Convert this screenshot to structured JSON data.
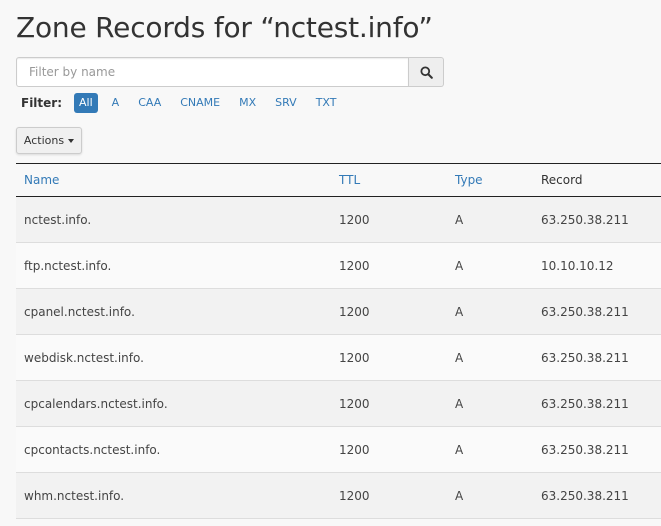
{
  "page": {
    "title": "Zone Records for “nctest.info”"
  },
  "search": {
    "placeholder": "Filter by name",
    "icon": "search-icon"
  },
  "filter": {
    "label": "Filter:",
    "options": [
      "All",
      "A",
      "CAA",
      "CNAME",
      "MX",
      "SRV",
      "TXT"
    ],
    "active": "All"
  },
  "actions": {
    "label": "Actions"
  },
  "table": {
    "columns": [
      "Name",
      "TTL",
      "Type",
      "Record"
    ],
    "rows": [
      [
        "nctest.info.",
        "1200",
        "A",
        "63.250.38.211"
      ],
      [
        "ftp.nctest.info.",
        "1200",
        "A",
        "10.10.10.12"
      ],
      [
        "cpanel.nctest.info.",
        "1200",
        "A",
        "63.250.38.211"
      ],
      [
        "webdisk.nctest.info.",
        "1200",
        "A",
        "63.250.38.211"
      ],
      [
        "cpcalendars.nctest.info.",
        "1200",
        "A",
        "63.250.38.211"
      ],
      [
        "cpcontacts.nctest.info.",
        "1200",
        "A",
        "63.250.38.211"
      ],
      [
        "whm.nctest.info.",
        "1200",
        "A",
        "63.250.38.211"
      ]
    ]
  },
  "colors": {
    "link": "#337ab7",
    "active_pill": "#337ab7",
    "background": "#f8f8f8"
  }
}
